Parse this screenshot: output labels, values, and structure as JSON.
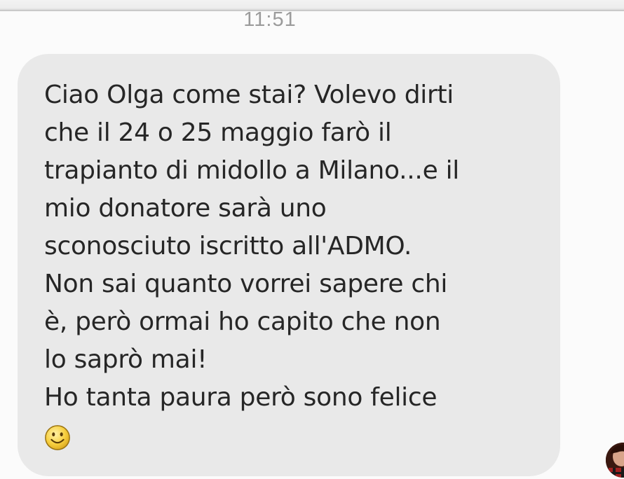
{
  "status": {
    "time": "11:51"
  },
  "message": {
    "text": "Ciao Olga come stai? Volevo dirti\nche il 24 o 25 maggio farò il\ntrapianto di midollo a Milano...e il\nmio donatore sarà uno\nsconosciuto iscritto all'ADMO.\nNon sai quanto vorrei sapere chi\nè, però ormai ho capito che non\nlo saprò mai!\nHo tanta paura però sono felice",
    "emoji": "smiling-face-icon"
  },
  "sender": {
    "avatar": "avatar-photo"
  },
  "colors": {
    "bubble": "#e9e9e9",
    "text": "#262626",
    "timestamp": "#9b9b9b",
    "emoji": "#f7cf3f"
  }
}
